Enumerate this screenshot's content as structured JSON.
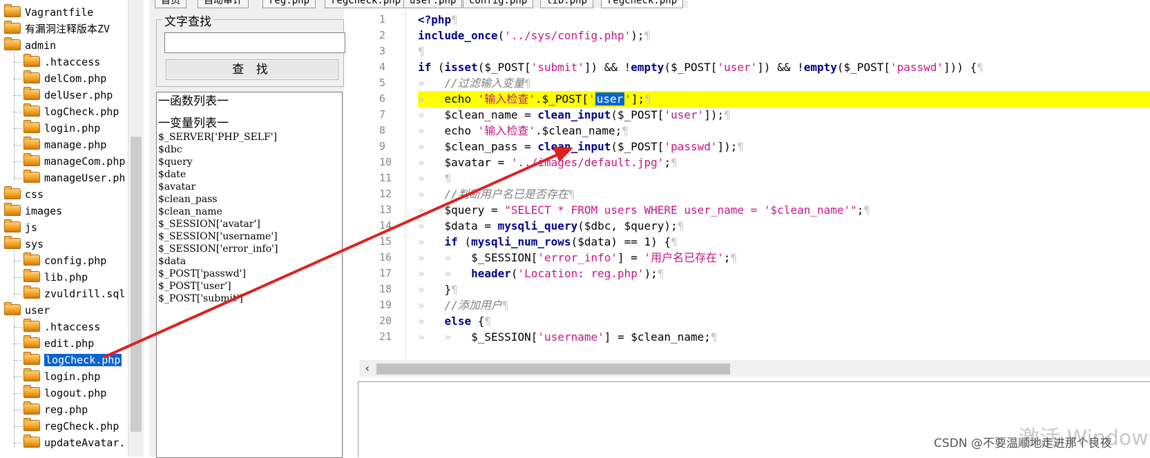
{
  "tabs": [
    "首页",
    "自动审计",
    "reg.php",
    "regCheck.php",
    "user.php",
    "config.php",
    "lib.php",
    "regCheck.php"
  ],
  "file_tree": [
    {
      "label": "Vagrantfile",
      "type": "folder",
      "indent": 0
    },
    {
      "label": "有漏洞注释版本ZV",
      "type": "folder",
      "indent": 0
    },
    {
      "label": "admin",
      "type": "folder",
      "indent": 0
    },
    {
      "label": ".htaccess",
      "type": "file",
      "indent": 1
    },
    {
      "label": "delCom.php",
      "type": "file",
      "indent": 1
    },
    {
      "label": "delUser.php",
      "type": "file",
      "indent": 1
    },
    {
      "label": "logCheck.php",
      "type": "file",
      "indent": 1
    },
    {
      "label": "login.php",
      "type": "file",
      "indent": 1
    },
    {
      "label": "manage.php",
      "type": "file",
      "indent": 1
    },
    {
      "label": "manageCom.php",
      "type": "file",
      "indent": 1
    },
    {
      "label": "manageUser.ph",
      "type": "file",
      "indent": 1
    },
    {
      "label": "css",
      "type": "folder",
      "indent": 0
    },
    {
      "label": "images",
      "type": "folder",
      "indent": 0
    },
    {
      "label": "js",
      "type": "folder",
      "indent": 0
    },
    {
      "label": "sys",
      "type": "folder",
      "indent": 0
    },
    {
      "label": "config.php",
      "type": "file",
      "indent": 1
    },
    {
      "label": "lib.php",
      "type": "file",
      "indent": 1
    },
    {
      "label": "zvuldrill.sql",
      "type": "file",
      "indent": 1
    },
    {
      "label": "user",
      "type": "folder",
      "indent": 0
    },
    {
      "label": ".htaccess",
      "type": "file",
      "indent": 1
    },
    {
      "label": "edit.php",
      "type": "file",
      "indent": 1
    },
    {
      "label": "logCheck.php",
      "type": "file",
      "indent": 1,
      "selected": true
    },
    {
      "label": "login.php",
      "type": "file",
      "indent": 1
    },
    {
      "label": "logout.php",
      "type": "file",
      "indent": 1
    },
    {
      "label": "reg.php",
      "type": "file",
      "indent": 1
    },
    {
      "label": "regCheck.php",
      "type": "file",
      "indent": 1
    },
    {
      "label": "updateAvatar.",
      "type": "file",
      "indent": 1
    }
  ],
  "search": {
    "group_title": "文字查找",
    "value": "",
    "button_label": "查 找"
  },
  "lists": {
    "functions_title": "一函数列表一",
    "variables_title": "一变量列表一",
    "variables": [
      "$_SERVER['PHP_SELF']",
      "$dbc",
      "$query",
      "$date",
      "$avatar",
      "$clean_pass",
      "$clean_name",
      "$_SESSION['avatar']",
      "$_SESSION['username']",
      "$_SESSION['error_info']",
      "$data",
      "$_POST['passwd']",
      "$_POST['user']",
      "$_POST['submit']"
    ]
  },
  "editor": {
    "line_numbers": [
      "1",
      "2",
      "3",
      "4",
      "5",
      "6",
      "7",
      "8",
      "9",
      "10",
      "11",
      "12",
      "13",
      "14",
      "15",
      "16",
      "17",
      "18",
      "19",
      "20",
      "21"
    ],
    "highlighted_line": 6,
    "selected_word": "user"
  },
  "footer": {
    "watermark": "激活 Window",
    "credit": "CSDN @不要温顺地走进那个良夜"
  },
  "colors": {
    "highlight": "#ffff00",
    "selection": "#0a64d2",
    "string": "#c71585",
    "keyword": "#00008b",
    "arrow": "#e02020"
  }
}
